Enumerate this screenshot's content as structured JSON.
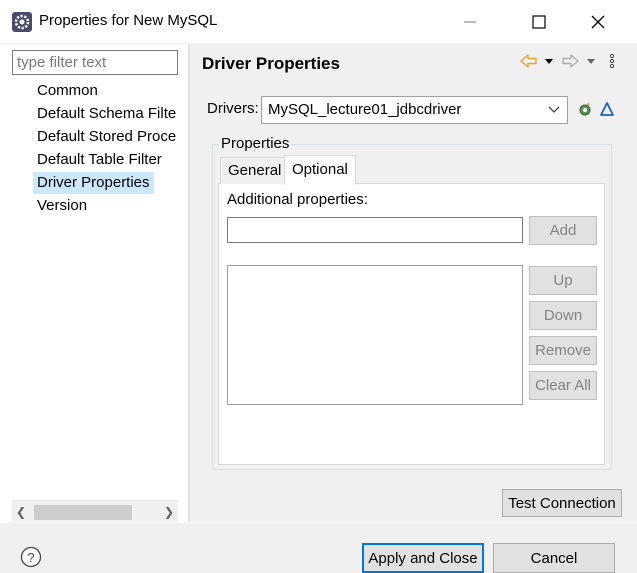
{
  "window": {
    "title": "Properties for New MySQL",
    "controls": {
      "minimize": "minimize",
      "maximize": "maximize",
      "close": "close"
    }
  },
  "sidebar": {
    "filter_placeholder": "type filter text",
    "filter_value": "",
    "items": [
      {
        "label": "Common",
        "selected": false
      },
      {
        "label": "Default Schema Filte",
        "selected": false
      },
      {
        "label": "Default Stored Proce",
        "selected": false
      },
      {
        "label": "Default Table Filter",
        "selected": false
      },
      {
        "label": "Driver Properties",
        "selected": true
      },
      {
        "label": "Version",
        "selected": false
      }
    ]
  },
  "page": {
    "title": "Driver Properties",
    "drivers_label": "Drivers:",
    "drivers_value": "MySQL_lecture01_jdbcdriver",
    "group_label": "Properties",
    "tabs": [
      {
        "label": "General",
        "active": false
      },
      {
        "label": "Optional",
        "active": true
      }
    ],
    "additional_label": "Additional properties:",
    "additional_value": "",
    "buttons": {
      "add": "Add",
      "up": "Up",
      "down": "Down",
      "remove": "Remove",
      "clear_all": "Clear All"
    },
    "test_connection": "Test Connection"
  },
  "footer": {
    "apply_close": "Apply and Close",
    "cancel": "Cancel"
  },
  "colors": {
    "selection": "#cce8ff",
    "accent": "#0078d7",
    "nav_back": "#e8a33d",
    "disabled_text": "#838383"
  }
}
